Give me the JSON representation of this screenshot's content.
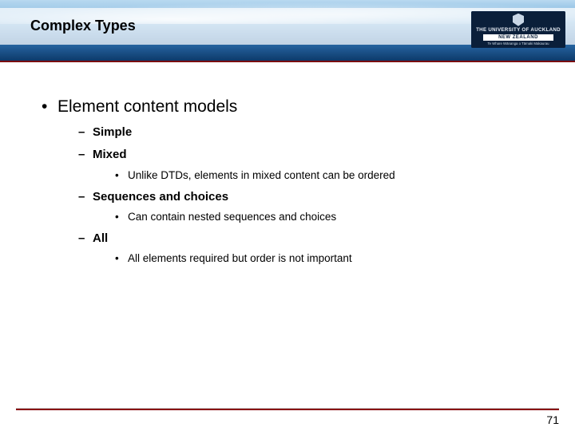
{
  "header": {
    "title": "Complex Types",
    "logo": {
      "line1": "THE UNIVERSITY OF",
      "line2": "AUCKLAND",
      "band": "NEW ZEALAND",
      "maori": "Te Whare Wānanga o Tāmaki Makaurau"
    }
  },
  "content": {
    "l1": "Element content models",
    "items": [
      {
        "label": "Simple",
        "sub": []
      },
      {
        "label": "Mixed",
        "sub": [
          "Unlike DTDs, elements in mixed content can be ordered"
        ]
      },
      {
        "label": "Sequences and choices",
        "sub": [
          "Can contain nested sequences and choices"
        ]
      },
      {
        "label": "All",
        "sub": [
          "All elements required but order is not important"
        ]
      }
    ]
  },
  "footer": {
    "page": "71"
  }
}
